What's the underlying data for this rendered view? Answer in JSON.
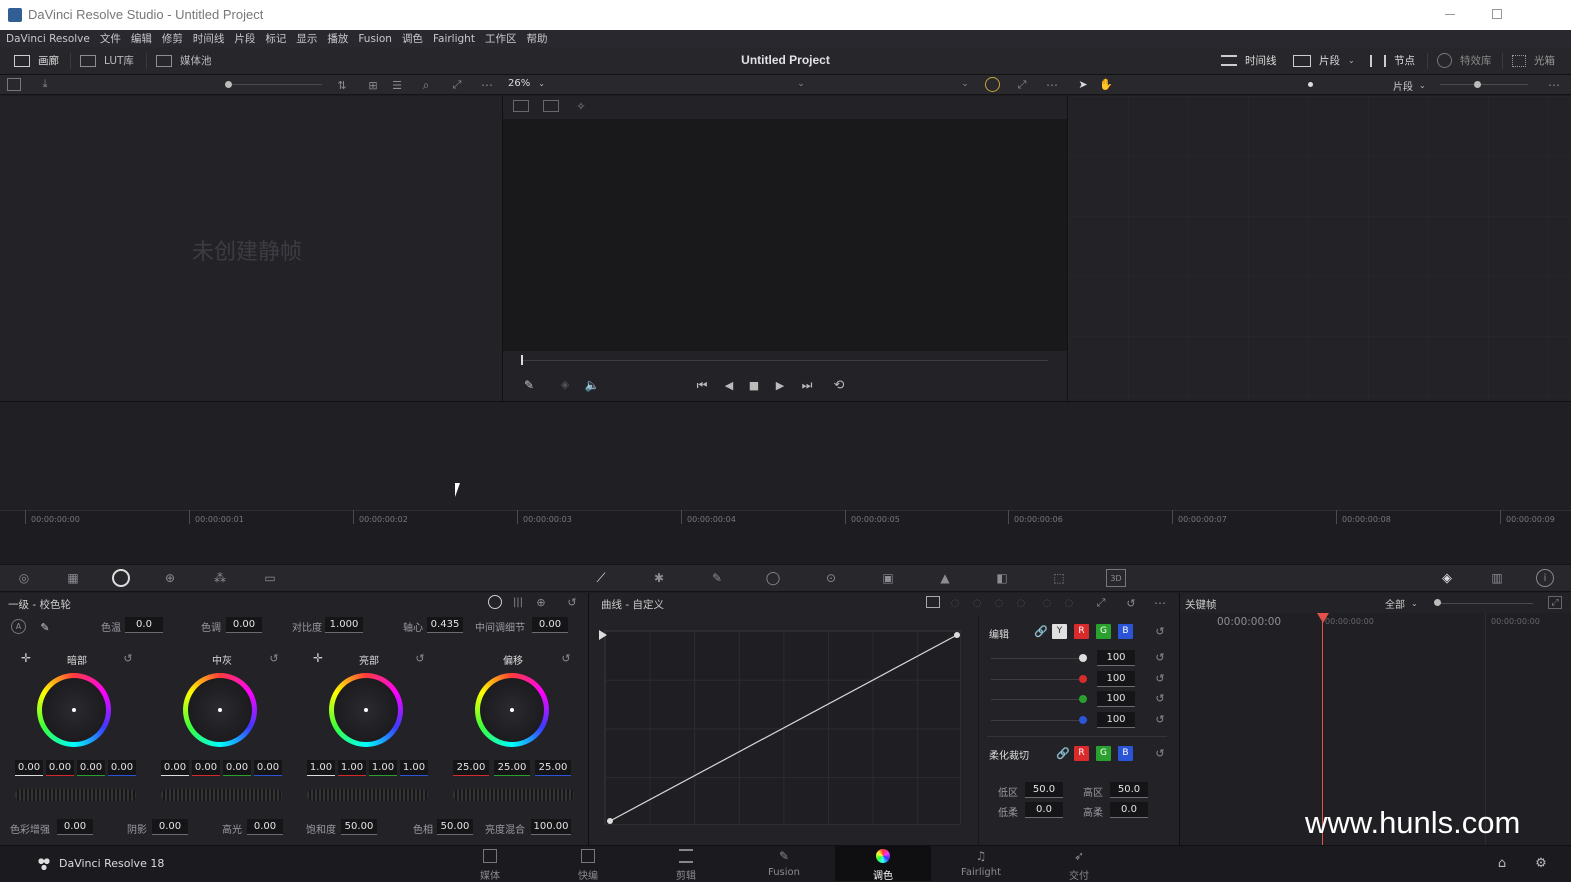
{
  "window": {
    "title": "DaVinci Resolve Studio - Untitled Project"
  },
  "menu": [
    "DaVinci Resolve",
    "文件",
    "编辑",
    "修剪",
    "时间线",
    "片段",
    "标记",
    "显示",
    "播放",
    "Fusion",
    "调色",
    "Fairlight",
    "工作区",
    "帮助"
  ],
  "toolbar": {
    "project_title": "Untitled Project",
    "left": [
      "画廊",
      "LUT库",
      "媒体池"
    ],
    "right": [
      "时间线",
      "片段",
      "节点",
      "特效库",
      "光箱"
    ]
  },
  "gallery": {
    "empty_text": "未创建静帧"
  },
  "viewer": {
    "zoom": "26%",
    "right_dropdown": "片段"
  },
  "timeline_ruler": [
    "00:00:00:00",
    "00:00:00:01",
    "00:00:00:02",
    "00:00:00:03",
    "00:00:00:04",
    "00:00:00:05",
    "00:00:00:06",
    "00:00:00:07",
    "00:00:00:08",
    "00:00:00:09"
  ],
  "primaries": {
    "title": "一级 - 校色轮",
    "top": [
      {
        "label": "色温",
        "value": "0.0"
      },
      {
        "label": "色调",
        "value": "0.00"
      },
      {
        "label": "对比度",
        "value": "1.000"
      },
      {
        "label": "轴心",
        "value": "0.435"
      },
      {
        "label": "中间调细节",
        "value": "0.00"
      }
    ],
    "wheels": [
      {
        "name": "暗部",
        "values": [
          "0.00",
          "0.00",
          "0.00",
          "0.00"
        ]
      },
      {
        "name": "中灰",
        "values": [
          "0.00",
          "0.00",
          "0.00",
          "0.00"
        ]
      },
      {
        "name": "亮部",
        "values": [
          "1.00",
          "1.00",
          "1.00",
          "1.00"
        ]
      },
      {
        "name": "偏移",
        "values": [
          "25.00",
          "25.00",
          "25.00"
        ]
      }
    ],
    "bottom": [
      {
        "label": "色彩增强",
        "value": "0.00"
      },
      {
        "label": "阴影",
        "value": "0.00"
      },
      {
        "label": "高光",
        "value": "0.00"
      },
      {
        "label": "饱和度",
        "value": "50.00"
      },
      {
        "label": "色相",
        "value": "50.00"
      },
      {
        "label": "亮度混合",
        "value": "100.00"
      }
    ]
  },
  "curves": {
    "title": "曲线 - 自定义",
    "edit_label": "编辑",
    "channels": [
      "Y",
      "R",
      "G",
      "B"
    ],
    "intensity": [
      "100",
      "100",
      "100",
      "100"
    ],
    "soft_clip_label": "柔化裁切",
    "soft_clip": [
      {
        "label": "低区",
        "value": "50.0"
      },
      {
        "label": "高区",
        "value": "50.0"
      },
      {
        "label": "低柔",
        "value": "0.0"
      },
      {
        "label": "高柔",
        "value": "0.0"
      }
    ]
  },
  "keyframes": {
    "title": "关键帧",
    "filter": "全部",
    "timecode": "00:00:00:00",
    "ruler_left": "00:00:00:00",
    "ruler_right": "00:00:00:00"
  },
  "pages": {
    "brand": "DaVinci Resolve 18",
    "items": [
      "媒体",
      "快编",
      "剪辑",
      "Fusion",
      "调色",
      "Fairlight",
      "交付"
    ],
    "active": 4
  },
  "watermark": "www.hunls.com",
  "colors": {
    "accent_red": "#d92b2b",
    "channel_r": "#d32b2b",
    "channel_g": "#2aa12e",
    "channel_b": "#2b55d6",
    "playhead": "#e3514a"
  }
}
